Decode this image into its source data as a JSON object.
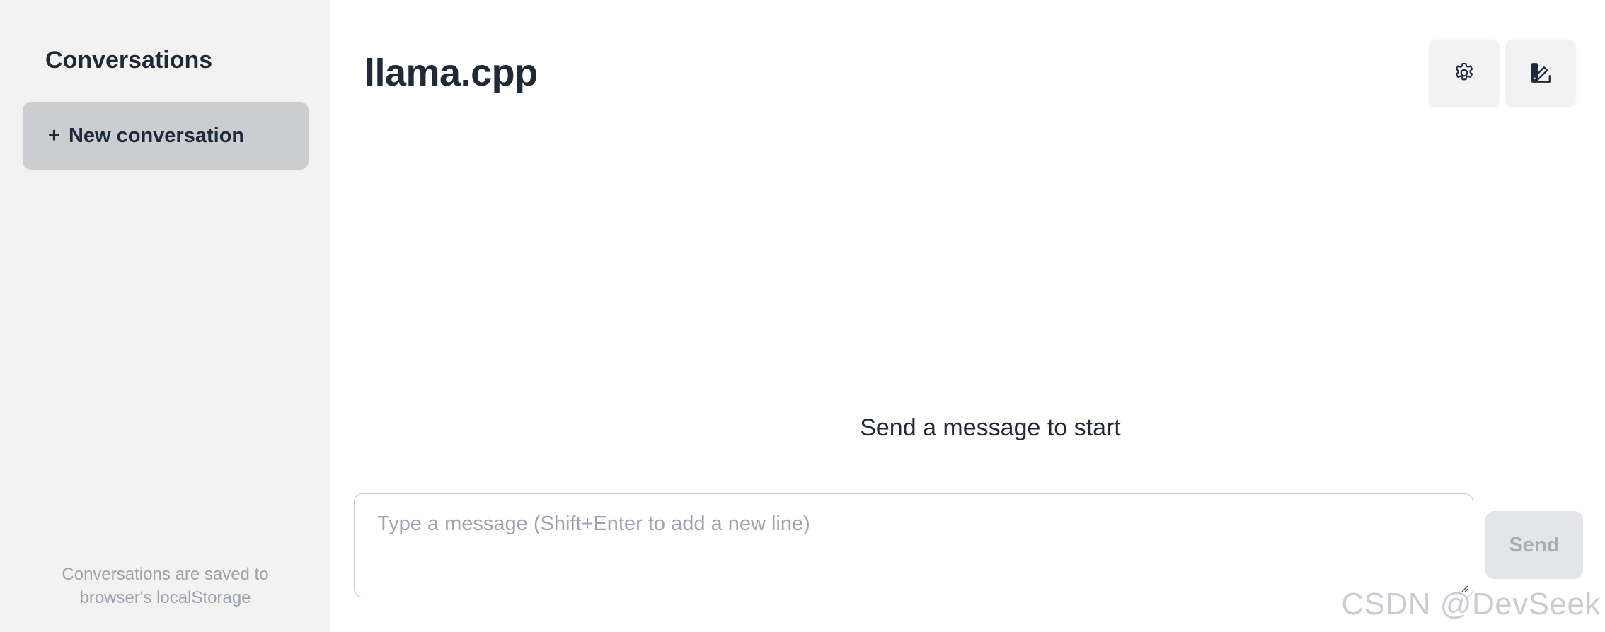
{
  "sidebar": {
    "title": "Conversations",
    "new_conversation_plus": "+",
    "new_conversation_label": "New conversation",
    "footer_line1": "Conversations are saved to",
    "footer_line2": "browser's localStorage"
  },
  "header": {
    "title": "llama.cpp",
    "settings_icon": "gear-icon",
    "theme_icon": "theme-swatch-icon"
  },
  "main": {
    "empty_hint": "Send a message to start"
  },
  "composer": {
    "placeholder": "Type a message (Shift+Enter to add a new line)",
    "send_label": "Send"
  },
  "watermark": "CSDN @DevSeek",
  "colors": {
    "sidebar_bg": "#f2f2f2",
    "new_conversation_bg": "#cccdd1",
    "text_primary": "#1f2937",
    "text_muted": "#9ca3af",
    "send_disabled_bg": "#e4e5e7"
  }
}
